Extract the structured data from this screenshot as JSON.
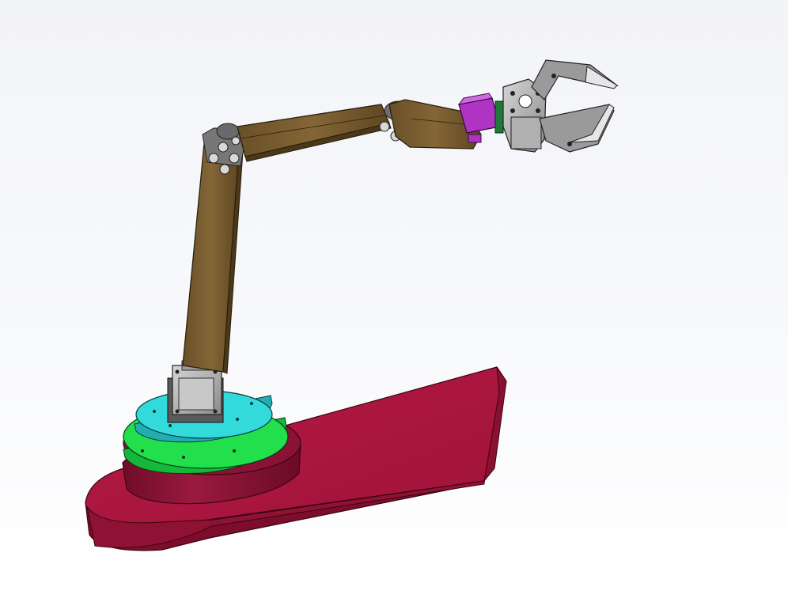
{
  "scene": {
    "subject": "robotic-arm-cad-model",
    "colors": {
      "background_top": "#f3f4f8",
      "background_bottom": "#ffffff",
      "base_plate": "#a8163f",
      "base_plate_side": "#7d0d2b",
      "pedestal": "#8c1236",
      "green_ring": "#1fe04a",
      "cyan_disc": "#2ed6d8",
      "arm_link": "#7a5e2e",
      "arm_link_dark": "#5a4420",
      "servo": "#b8b8b8",
      "purple_servo": "#b034c4",
      "gripper": "#9c9c9c"
    }
  }
}
